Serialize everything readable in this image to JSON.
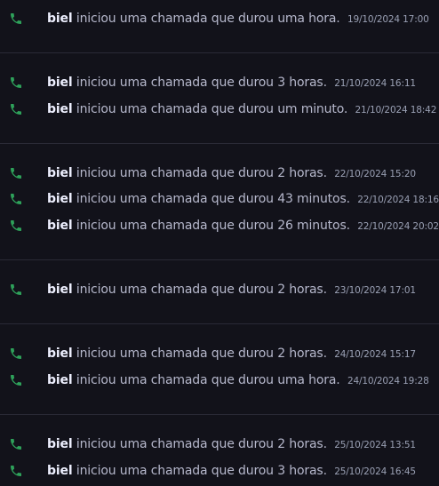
{
  "colors": {
    "background": "#12121a",
    "divider": "#2a2a36",
    "phone_icon": "#2ea15a",
    "username": "#eef0ff",
    "message_text": "#b6b8cc",
    "timestamp": "#9aa0b4"
  },
  "messages": [
    {
      "user": "biel",
      "text": "iniciou uma chamada que durou uma hora.",
      "time": "19/10/2024 17:00",
      "icon": "phone-icon"
    },
    {
      "user": "biel",
      "text": "iniciou uma chamada que durou 3 horas.",
      "time": "21/10/2024 16:11",
      "icon": "phone-icon"
    },
    {
      "user": "biel",
      "text": "iniciou uma chamada que durou um minuto.",
      "time": "21/10/2024 18:42",
      "icon": "phone-icon"
    },
    {
      "user": "biel",
      "text": "iniciou uma chamada que durou 2 horas.",
      "time": "22/10/2024 15:20",
      "icon": "phone-icon"
    },
    {
      "user": "biel",
      "text": "iniciou uma chamada que durou 43 minutos.",
      "time": "22/10/2024 18:16",
      "icon": "phone-icon"
    },
    {
      "user": "biel",
      "text": "iniciou uma chamada que durou 26 minutos.",
      "time": "22/10/2024 20:02",
      "icon": "phone-icon"
    },
    {
      "user": "biel",
      "text": "iniciou uma chamada que durou 2 horas.",
      "time": "23/10/2024 17:01",
      "icon": "phone-icon"
    },
    {
      "user": "biel",
      "text": "iniciou uma chamada que durou 2 horas.",
      "time": "24/10/2024 15:17",
      "icon": "phone-icon"
    },
    {
      "user": "biel",
      "text": "iniciou uma chamada que durou uma hora.",
      "time": "24/10/2024 19:28",
      "icon": "phone-icon"
    },
    {
      "user": "biel",
      "text": "iniciou uma chamada que durou 2 horas.",
      "time": "25/10/2024 13:51",
      "icon": "phone-icon"
    },
    {
      "user": "biel",
      "text": "iniciou uma chamada que durou 3 horas.",
      "time": "25/10/2024 16:45",
      "icon": "phone-icon"
    }
  ]
}
